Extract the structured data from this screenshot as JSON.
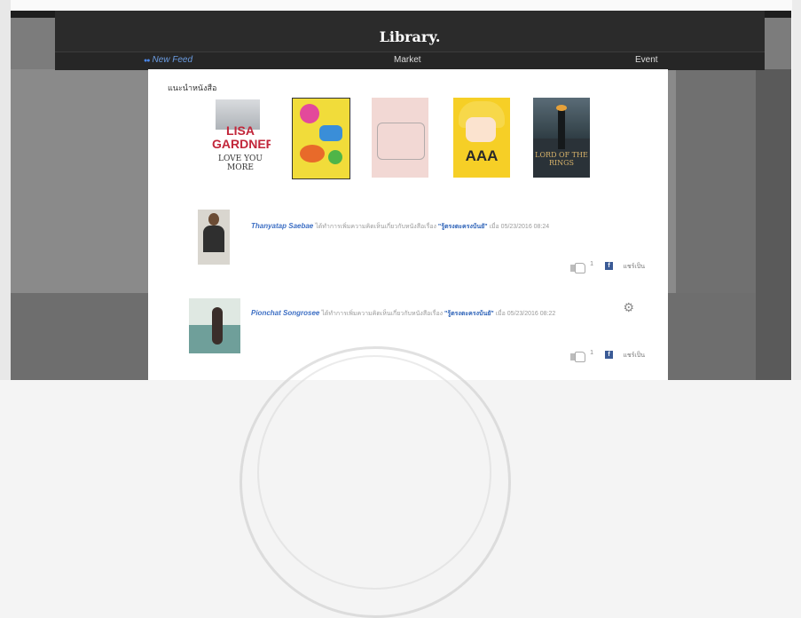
{
  "app": {
    "title": "Library."
  },
  "nav": {
    "items": [
      {
        "label": "New Feed",
        "active": true
      },
      {
        "label": "Market",
        "active": false
      },
      {
        "label": "Event",
        "active": false
      }
    ]
  },
  "recommend": {
    "title": "แนะนำหนังสือ",
    "books": [
      {
        "cover_title": "LISA GARDNER",
        "cover_sub": "LOVE YOU MORE"
      },
      {
        "cover_title": "",
        "cover_sub": ""
      },
      {
        "cover_title": "",
        "cover_sub": ""
      },
      {
        "cover_title": "AAA",
        "cover_sub": ""
      },
      {
        "cover_title": "LORD OF THE RINGS",
        "cover_sub": ""
      }
    ]
  },
  "feed": [
    {
      "user": "Thanyatap Saebae",
      "action": "ได้ทำการเพิ่มความคิดเห็นเกี่ยวกับหนังสือเรื่อง",
      "book": "\"รู้ตรงตะครงบ้นยั\"",
      "date_prefix": "เมื่อ",
      "date": "05/23/2016 08:24",
      "like_count": "1",
      "share_label": "แชร์เป็น"
    },
    {
      "user": "Pionchat Songrosee",
      "action": "ได้ทำการเพิ่มความคิดเห็นเกี่ยวกับหนังสือเรื่อง",
      "book": "\"รู้ตรงตะครงบ้นยั\"",
      "date_prefix": "เมื่อ",
      "date": "05/23/2016 08:22",
      "like_count": "1",
      "share_label": "แชร์เป็น"
    }
  ],
  "icons": {
    "menu": "hamburger-icon",
    "like": "thumbs-up-icon",
    "facebook": "facebook-icon",
    "settings": "gear-icon"
  },
  "colors": {
    "header": "#2b2b2b",
    "accent": "#3d6fc4",
    "facebook": "#3b5b96"
  }
}
